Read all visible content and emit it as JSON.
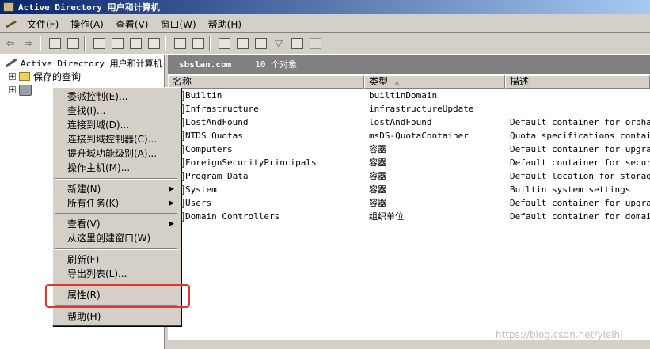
{
  "window": {
    "title": "Active Directory 用户和计算机"
  },
  "menubar": {
    "items": [
      "文件(F)",
      "操作(A)",
      "查看(V)",
      "窗口(W)",
      "帮助(H)"
    ]
  },
  "tree": {
    "root_label": "Active Directory 用户和计算机",
    "saved_queries": "保存的查询"
  },
  "header": {
    "path": "sbslan.com",
    "count": "10 个对象"
  },
  "list": {
    "columns": [
      "名称",
      "类型",
      "描述"
    ],
    "sort_indicator": "▲",
    "rows": [
      {
        "name": "Builtin",
        "type": "builtinDomain",
        "desc": ""
      },
      {
        "name": "Infrastructure",
        "type": "infrastructureUpdate",
        "desc": ""
      },
      {
        "name": "LostAndFound",
        "type": "lostAndFound",
        "desc": "Default container for orphaned"
      },
      {
        "name": "NTDS Quotas",
        "type": "msDS-QuotaContainer",
        "desc": "Quota specifications container"
      },
      {
        "name": "Computers",
        "type": "容器",
        "desc": "Default container for upgraded"
      },
      {
        "name": "ForeignSecurityPrincipals",
        "type": "容器",
        "desc": "Default container for security"
      },
      {
        "name": "Program Data",
        "type": "容器",
        "desc": "Default location for storage o"
      },
      {
        "name": "System",
        "type": "容器",
        "desc": "Builtin system settings"
      },
      {
        "name": "Users",
        "type": "容器",
        "desc": "Default container for upgraded"
      },
      {
        "name": "Domain Controllers",
        "type": "组织单位",
        "desc": "Default container for domain c"
      }
    ]
  },
  "context_menu": {
    "items": [
      {
        "label": "委派控制(E)...",
        "submenu": false
      },
      {
        "label": "查找(I)...",
        "submenu": false
      },
      {
        "label": "连接到域(D)...",
        "submenu": false
      },
      {
        "label": "连接到域控制器(C)...",
        "submenu": false
      },
      {
        "label": "提升域功能级别(A)...",
        "submenu": false
      },
      {
        "label": "操作主机(M)...",
        "submenu": false
      },
      {
        "label": "新建(N)",
        "submenu": true
      },
      {
        "label": "所有任务(K)",
        "submenu": true
      },
      {
        "label": "查看(V)",
        "submenu": true
      },
      {
        "label": "从这里创建窗口(W)",
        "submenu": false
      },
      {
        "label": "刷新(F)",
        "submenu": false
      },
      {
        "label": "导出列表(L)...",
        "submenu": false
      },
      {
        "label": "属性(R)",
        "submenu": false
      },
      {
        "label": "帮助(H)",
        "submenu": false
      }
    ],
    "submenu_arrow": "▶"
  },
  "watermark": "https://blog.csdn.net/yleihj",
  "colors": {
    "title_active": "#0a246a",
    "highlight_box": "#e8342f",
    "face": "#d4d0c8"
  }
}
